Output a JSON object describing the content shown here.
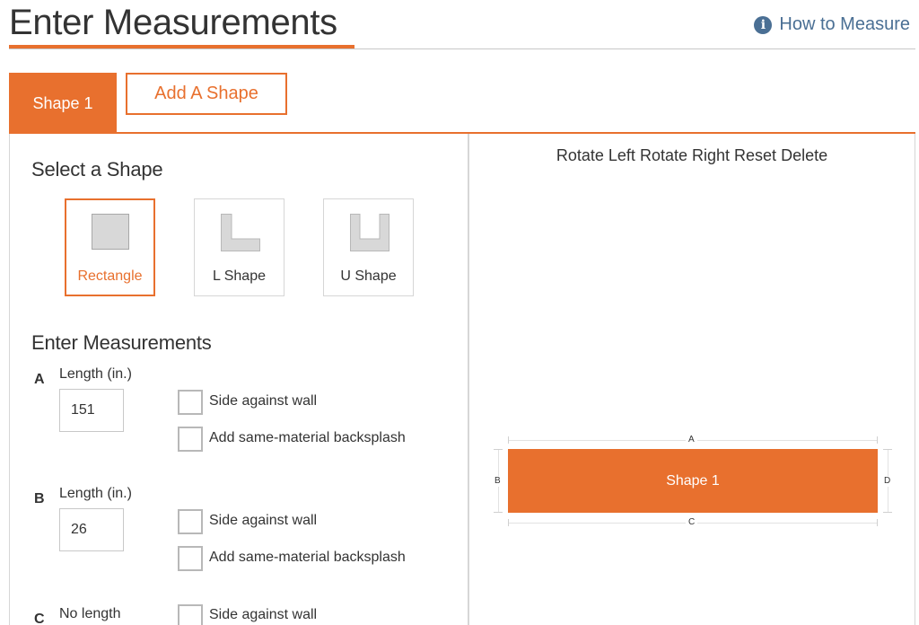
{
  "header": {
    "title": "Enter Measurements",
    "help_link": {
      "icon": "info-icon",
      "label": "How to Measure"
    }
  },
  "tabs": {
    "active_tab": "Shape 1",
    "add_button": "Add A Shape"
  },
  "left": {
    "select_title": "Select a Shape",
    "shapes": [
      {
        "label": "Rectangle",
        "icon": "rectangle-shape-icon",
        "selected": true
      },
      {
        "label": "L Shape",
        "icon": "l-shape-icon",
        "selected": false
      },
      {
        "label": "U Shape",
        "icon": "u-shape-icon",
        "selected": false
      }
    ],
    "measure_title": "Enter Measurements",
    "sides": [
      {
        "letter": "A",
        "label": "Length (in.)",
        "value": "151",
        "wall": "Side against wall",
        "wall_checked": false,
        "backsplash": "Add same-material backsplash",
        "backsplash_checked": false
      },
      {
        "letter": "B",
        "label": "Length (in.)",
        "value": "26",
        "wall": "Side against wall",
        "wall_checked": false,
        "backsplash": "Add same-material backsplash",
        "backsplash_checked": false
      },
      {
        "letter": "C",
        "label": "No length",
        "wall": "Side against wall",
        "wall_checked": false
      }
    ]
  },
  "right": {
    "toolbar": [
      "Rotate Left",
      "Rotate Right",
      "Reset",
      "Delete"
    ],
    "canvas": {
      "shape_label": "Shape 1",
      "dimension_labels": {
        "top": "A",
        "left": "B",
        "bottom": "C",
        "right": "D"
      }
    }
  },
  "colors": {
    "accent": "#e8702e",
    "link": "#4a6f94",
    "border": "#d6d6d6",
    "shape_fill": "#d8d8d8"
  }
}
